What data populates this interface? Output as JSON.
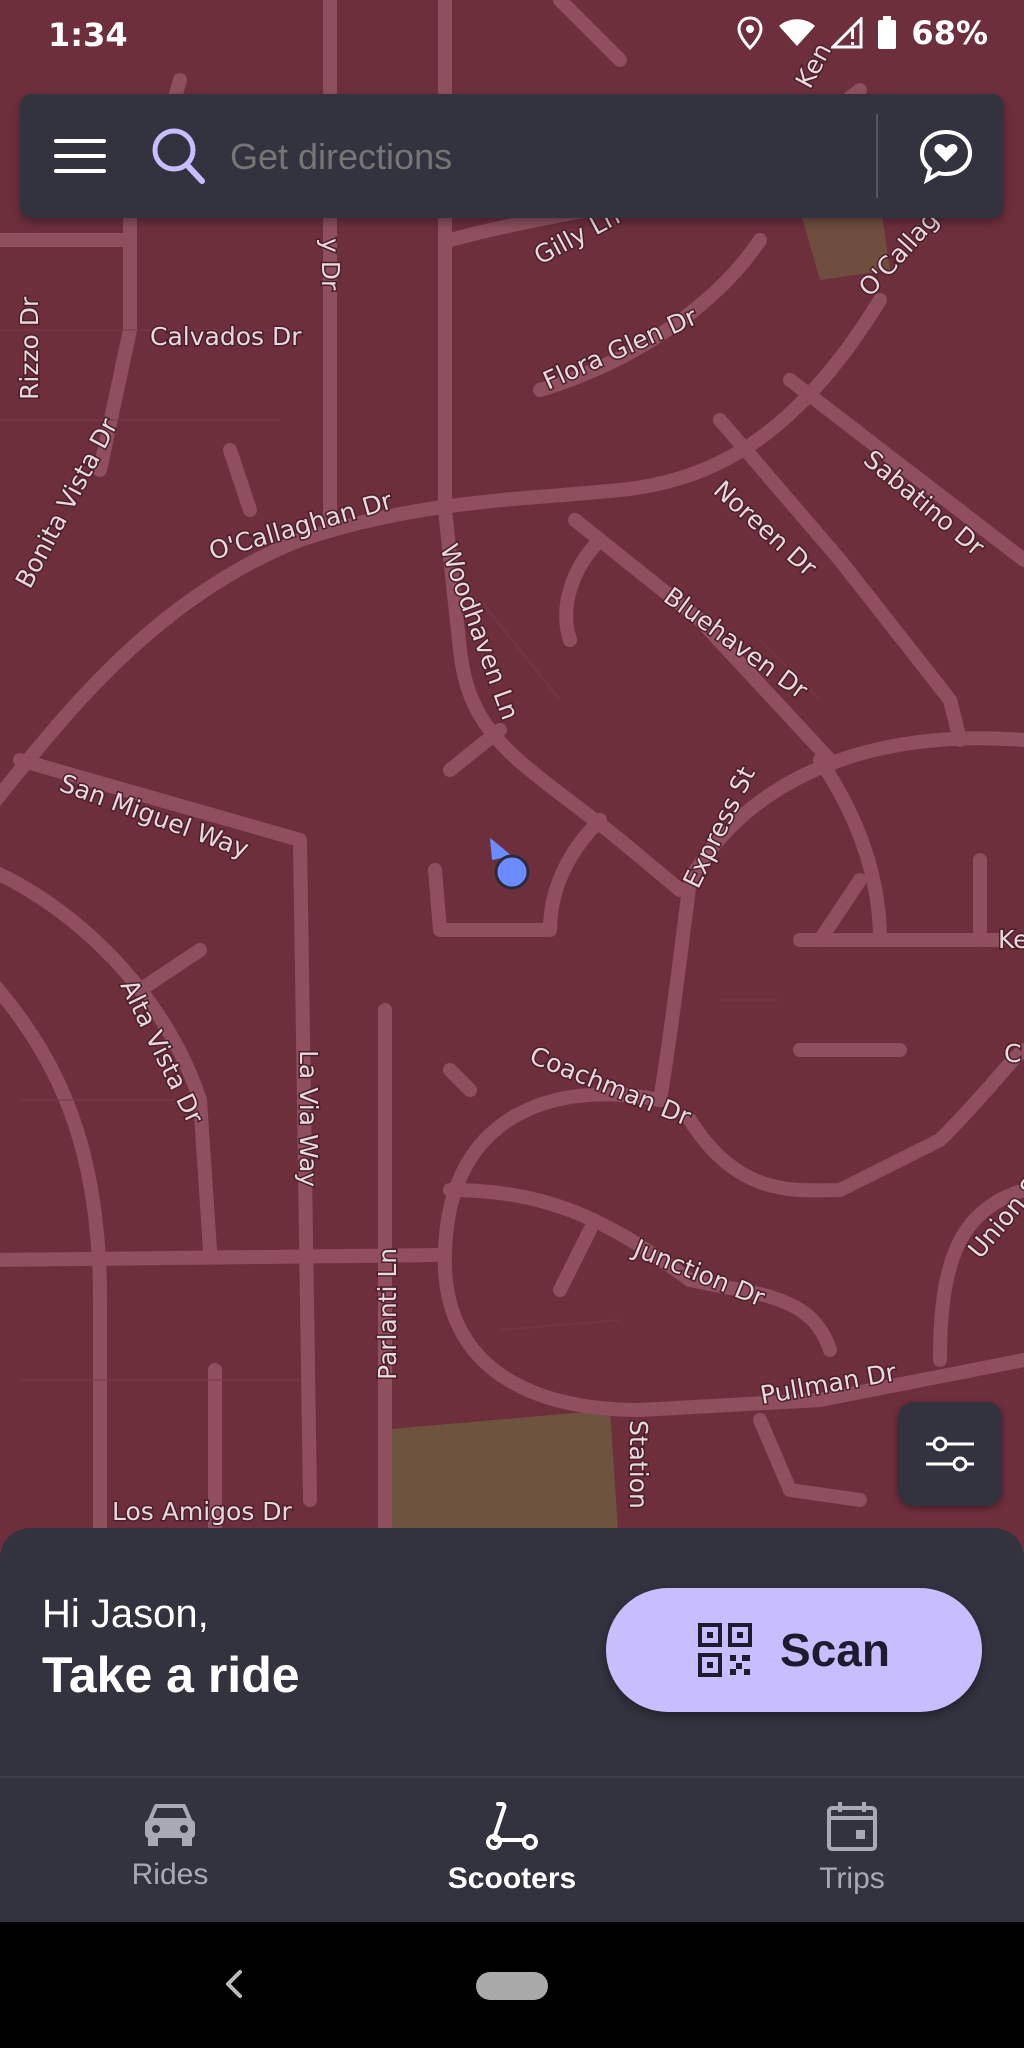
{
  "status_bar": {
    "time": "1:34",
    "battery": "68%"
  },
  "search": {
    "placeholder": "Get directions"
  },
  "map": {
    "streets": [
      "Gilly Ln",
      "Calvados Dr",
      "Flora Glen Dr",
      "O'Callaghan Dr",
      "Sabatino Dr",
      "Rizzo Dr",
      "Bonita Vista Dr",
      "Noreen Dr",
      "Woodhaven Ln",
      "Bluehaven Dr",
      "San Miguel Way",
      "Express St",
      "Alta Vista Dr",
      "La Via Way",
      "Coachman Dr",
      "Parlanti Ln",
      "Junction Dr",
      "Union St",
      "Pullman Dr",
      "Station",
      "Los Amigos Dr",
      "Ke",
      "C",
      "y Dr",
      "Ken"
    ],
    "colors": {
      "background": "#6e2f3d",
      "road": "#8f4f5f",
      "park": "#6f5b3e",
      "location_dot": "#6a8cff"
    }
  },
  "greeting": {
    "line1": "Hi Jason,",
    "line2": "Take a ride"
  },
  "scan_button": {
    "label": "Scan",
    "icon": "qr-code-icon"
  },
  "tabs": [
    {
      "label": "Rides",
      "icon": "car-icon",
      "active": false
    },
    {
      "label": "Scooters",
      "icon": "scooter-icon",
      "active": true
    },
    {
      "label": "Trips",
      "icon": "calendar-icon",
      "active": false
    }
  ]
}
